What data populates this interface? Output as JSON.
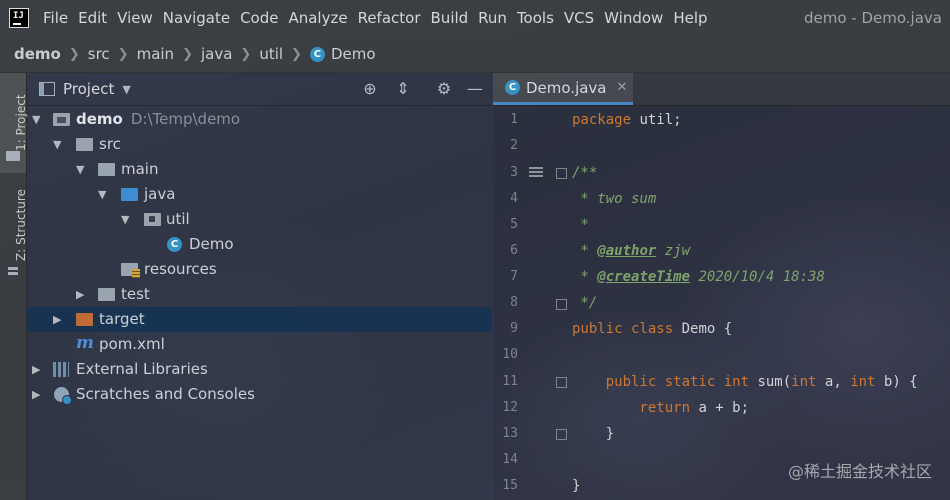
{
  "app": {
    "icon_label": "IJ",
    "window_title": "demo - Demo.java"
  },
  "menu": [
    "File",
    "Edit",
    "View",
    "Navigate",
    "Code",
    "Analyze",
    "Refactor",
    "Build",
    "Run",
    "Tools",
    "VCS",
    "Window",
    "Help"
  ],
  "breadcrumb": [
    "demo",
    "src",
    "main",
    "java",
    "util",
    "Demo"
  ],
  "toolstrip": {
    "project_tab": "1: Project",
    "structure_tab": "Z: Structure"
  },
  "project_panel": {
    "title": "Project",
    "tree": [
      {
        "label": "demo",
        "hint": "D:\\Temp\\demo",
        "bold": true
      },
      {
        "label": "src"
      },
      {
        "label": "main"
      },
      {
        "label": "java"
      },
      {
        "label": "util"
      },
      {
        "label": "Demo"
      },
      {
        "label": "resources"
      },
      {
        "label": "test"
      },
      {
        "label": "target"
      },
      {
        "label": "pom.xml"
      },
      {
        "label": "External Libraries"
      },
      {
        "label": "Scratches and Consoles"
      }
    ]
  },
  "editor": {
    "tab_label": "Demo.java",
    "line_numbers": [
      "1",
      "2",
      "3",
      "4",
      "5",
      "6",
      "7",
      "8",
      "9",
      "10",
      "11",
      "12",
      "13",
      "14",
      "15"
    ],
    "code": {
      "l1_kw": "package",
      "l1_rest": " util;",
      "l3": "/**",
      "l4": " * two sum",
      "l5": " *",
      "l6_pre": " * ",
      "l6_tag": "@author",
      "l6_rest": " zjw",
      "l7_pre": " * ",
      "l7_tag": "@createTime",
      "l7_rest": " 2020/10/4 18:38",
      "l8": " */",
      "l9_kw": "public class",
      "l9_cls": " Demo",
      "l9_rest": " {",
      "l11_kw1": "    public static int",
      "l11_fn": " sum",
      "l11_p1": "(",
      "l11_kw2": "int",
      "l11_p2": " a, ",
      "l11_kw3": "int",
      "l11_p3": " b) {",
      "l12_kw": "        return",
      "l12_rest": " a + b;",
      "l13": "    }",
      "l15": "}"
    }
  },
  "watermark": "@稀土掘金技术社区",
  "colors": {
    "selection": "#133253",
    "keyword": "#cc7832",
    "comment": "#7fa36a",
    "tab_underline": "#4a88c7"
  }
}
